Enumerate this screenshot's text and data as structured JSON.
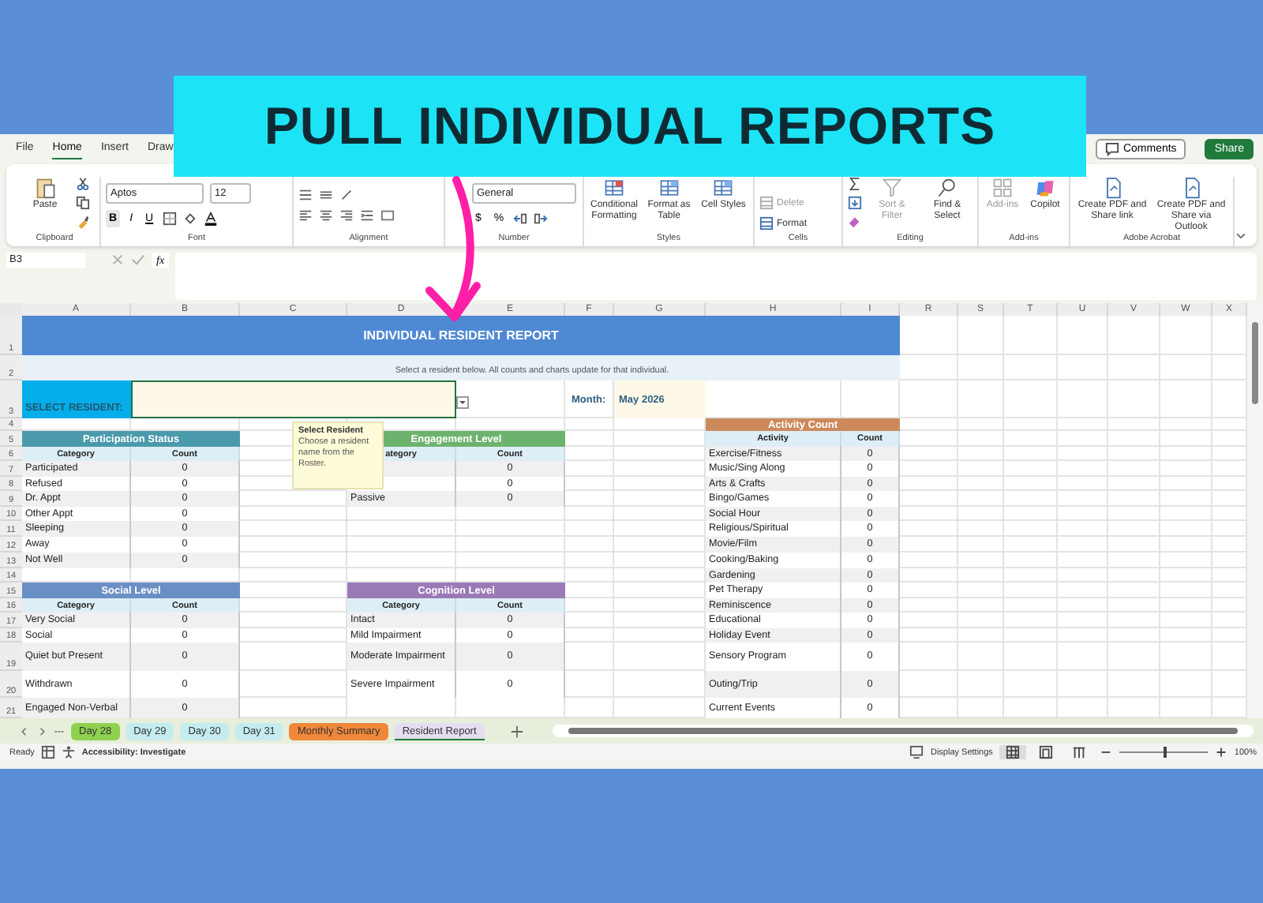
{
  "banner": {
    "text": "PULL INDIVIDUAL REPORTS"
  },
  "menu_tabs": [
    {
      "label": "File",
      "selected": false
    },
    {
      "label": "Home",
      "selected": true
    },
    {
      "label": "Insert",
      "selected": false
    },
    {
      "label": "Draw",
      "selected": false
    }
  ],
  "top_buttons": {
    "comments": "Comments",
    "share": "Share"
  },
  "ribbon": {
    "clipboard": {
      "label": "Clipboard",
      "paste": "Paste"
    },
    "font": {
      "label": "Font",
      "family": "Aptos",
      "size": "12",
      "bold": "B",
      "italic": "I",
      "underline": "U"
    },
    "alignment": {
      "label": "Alignment"
    },
    "number": {
      "label": "Number",
      "format": "General",
      "currency": "$",
      "percent": "%"
    },
    "styles": {
      "label": "Styles",
      "buttons": [
        {
          "label": "Conditional Formatting",
          "disabled": false
        },
        {
          "label": "Format as Table",
          "disabled": false
        },
        {
          "label": "Cell Styles",
          "disabled": false
        }
      ]
    },
    "cells": {
      "label": "Cells",
      "buttons": [
        {
          "label": "Delete",
          "disabled": true
        },
        {
          "label": "Format",
          "disabled": false
        }
      ]
    },
    "editing": {
      "label": "Editing",
      "buttons": [
        {
          "label": "Sort & Filter",
          "disabled": true
        },
        {
          "label": "Find & Select",
          "disabled": false
        }
      ]
    },
    "addins": {
      "label": "Add-ins",
      "buttons": [
        {
          "label": "Add-ins",
          "disabled": true
        },
        {
          "label": "Copilot",
          "disabled": false
        }
      ]
    },
    "acrobat": {
      "label": "Adobe Acrobat",
      "buttons": [
        {
          "label": "Create PDF and Share link",
          "disabled": false
        },
        {
          "label": "Create PDF and Share via Outlook",
          "disabled": false
        }
      ]
    }
  },
  "formula_bar": {
    "name_box": "B3",
    "fx": "fx"
  },
  "sheet": {
    "columns": [
      "A",
      "B",
      "C",
      "D",
      "E",
      "F",
      "G",
      "H",
      "I",
      "R",
      "S",
      "T",
      "U",
      "V",
      "W",
      "X"
    ],
    "rows": [
      "1",
      "2",
      "3",
      "4",
      "5",
      "6",
      "7",
      "8",
      "9",
      "10",
      "11",
      "12",
      "13",
      "14",
      "15",
      "16",
      "17",
      "18",
      "19",
      "20",
      "21"
    ]
  },
  "report": {
    "title": "INDIVIDUAL RESIDENT REPORT",
    "subtitle": "Select a resident below. All counts and charts update for that individual.",
    "select_label": "SELECT RESIDENT:",
    "month_label": "Month:",
    "month_value": "May 2026"
  },
  "tables": [
    {
      "title": "Participation Status",
      "color": "#4a9aab",
      "headers": [
        "Category",
        "Count"
      ],
      "rows": [
        {
          "label": "Participated",
          "count": "0"
        },
        {
          "label": "Refused",
          "count": "0"
        },
        {
          "label": "Dr. Appt",
          "count": "0"
        },
        {
          "label": "Other Appt",
          "count": "0"
        },
        {
          "label": "Sleeping",
          "count": "0"
        },
        {
          "label": "Away",
          "count": "0"
        },
        {
          "label": "Not Well",
          "count": "0"
        }
      ]
    },
    {
      "title": "Engagement Level",
      "color": "#6db36d",
      "headers": [
        "ategory",
        "Count"
      ],
      "rows": [
        {
          "count": "0"
        },
        {
          "count": "0"
        },
        {
          "label": "Passive",
          "count": "0"
        }
      ]
    },
    {
      "title": "Social Level",
      "color": "#6a8fc4",
      "headers": [
        "Category",
        "Count"
      ],
      "rows": [
        {
          "label": "Very Social",
          "count": "0"
        },
        {
          "label": "Social",
          "count": "0"
        },
        {
          "label": "Quiet but Present",
          "count": "0"
        },
        {
          "label": "Withdrawn",
          "count": "0"
        },
        {
          "label": "Engaged Non-Verbal",
          "count": "0"
        }
      ]
    },
    {
      "title": "Cognition Level",
      "color": "#9a7ab6",
      "headers": [
        "Category",
        "Count"
      ],
      "rows": [
        {
          "label": "Intact",
          "count": "0"
        },
        {
          "label": "Mild Impairment",
          "count": "0"
        },
        {
          "label": "Moderate Impairment",
          "count": "0"
        },
        {
          "label": "Severe Impairment",
          "count": "0"
        }
      ]
    },
    {
      "title": "Activity Count",
      "color": "#cc8a5c",
      "headers": [
        "Activity",
        "Count"
      ],
      "rows": [
        {
          "label": "Exercise/Fitness",
          "count": "0"
        },
        {
          "label": "Music/Sing Along",
          "count": "0"
        },
        {
          "label": "Arts & Crafts",
          "count": "0"
        },
        {
          "label": "Bingo/Games",
          "count": "0"
        },
        {
          "label": "Social Hour",
          "count": "0"
        },
        {
          "label": "Religious/Spiritual",
          "count": "0"
        },
        {
          "label": "Movie/Film",
          "count": "0"
        },
        {
          "label": "Cooking/Baking",
          "count": "0"
        },
        {
          "label": "Gardening",
          "count": "0"
        },
        {
          "label": "Pet Therapy",
          "count": "0"
        },
        {
          "label": "Reminiscence",
          "count": "0"
        },
        {
          "label": "Educational",
          "count": "0"
        },
        {
          "label": "Holiday Event",
          "count": "0"
        },
        {
          "label": "Sensory Program",
          "count": "0"
        },
        {
          "label": "Outing/Trip",
          "count": "0"
        },
        {
          "label": "Current Events",
          "count": "0"
        }
      ]
    }
  ],
  "tooltip": {
    "title": "Select Resident",
    "text": "Choose a resident name from the Roster."
  },
  "sheet_tabs": [
    {
      "label": "Day 28",
      "color": "#8fd14f",
      "selected": false
    },
    {
      "label": "Day 29",
      "color": "#c4ecee",
      "selected": false
    },
    {
      "label": "Day 30",
      "color": "#c4ecee",
      "selected": false
    },
    {
      "label": "Day 31",
      "color": "#c4ecee",
      "selected": false
    },
    {
      "label": "Monthly Summary",
      "color": "#f0883a",
      "selected": false
    },
    {
      "label": "Resident Report",
      "color": "#e4def0",
      "selected": true
    }
  ],
  "status": {
    "ready": "Ready",
    "accessibility": "Accessibility: Investigate",
    "display_settings": "Display Settings",
    "zoom": "100%",
    "zoom_slider": {
      "level": 0.5
    }
  }
}
